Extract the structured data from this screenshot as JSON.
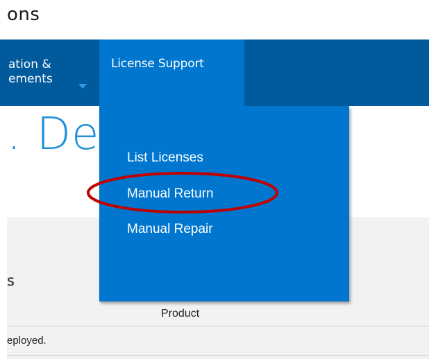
{
  "page": {
    "top_title": "ons",
    "heading": ". Del"
  },
  "navbar": {
    "left_item_line1": "ation &",
    "left_item_line2": "ements",
    "active_item": "License Support"
  },
  "dropdown": {
    "items": [
      {
        "label": "List Licenses"
      },
      {
        "label": "Manual Return"
      },
      {
        "label": "Manual Repair"
      }
    ],
    "highlighted_item": "Manual Return",
    "highlight_color": "#c00000"
  },
  "content": {
    "section_label": "s",
    "table_header": "Product",
    "row_text": "eployed."
  },
  "colors": {
    "navbar": "#005a9b",
    "menu": "#0076ce",
    "heading": "#1e8fd8"
  }
}
